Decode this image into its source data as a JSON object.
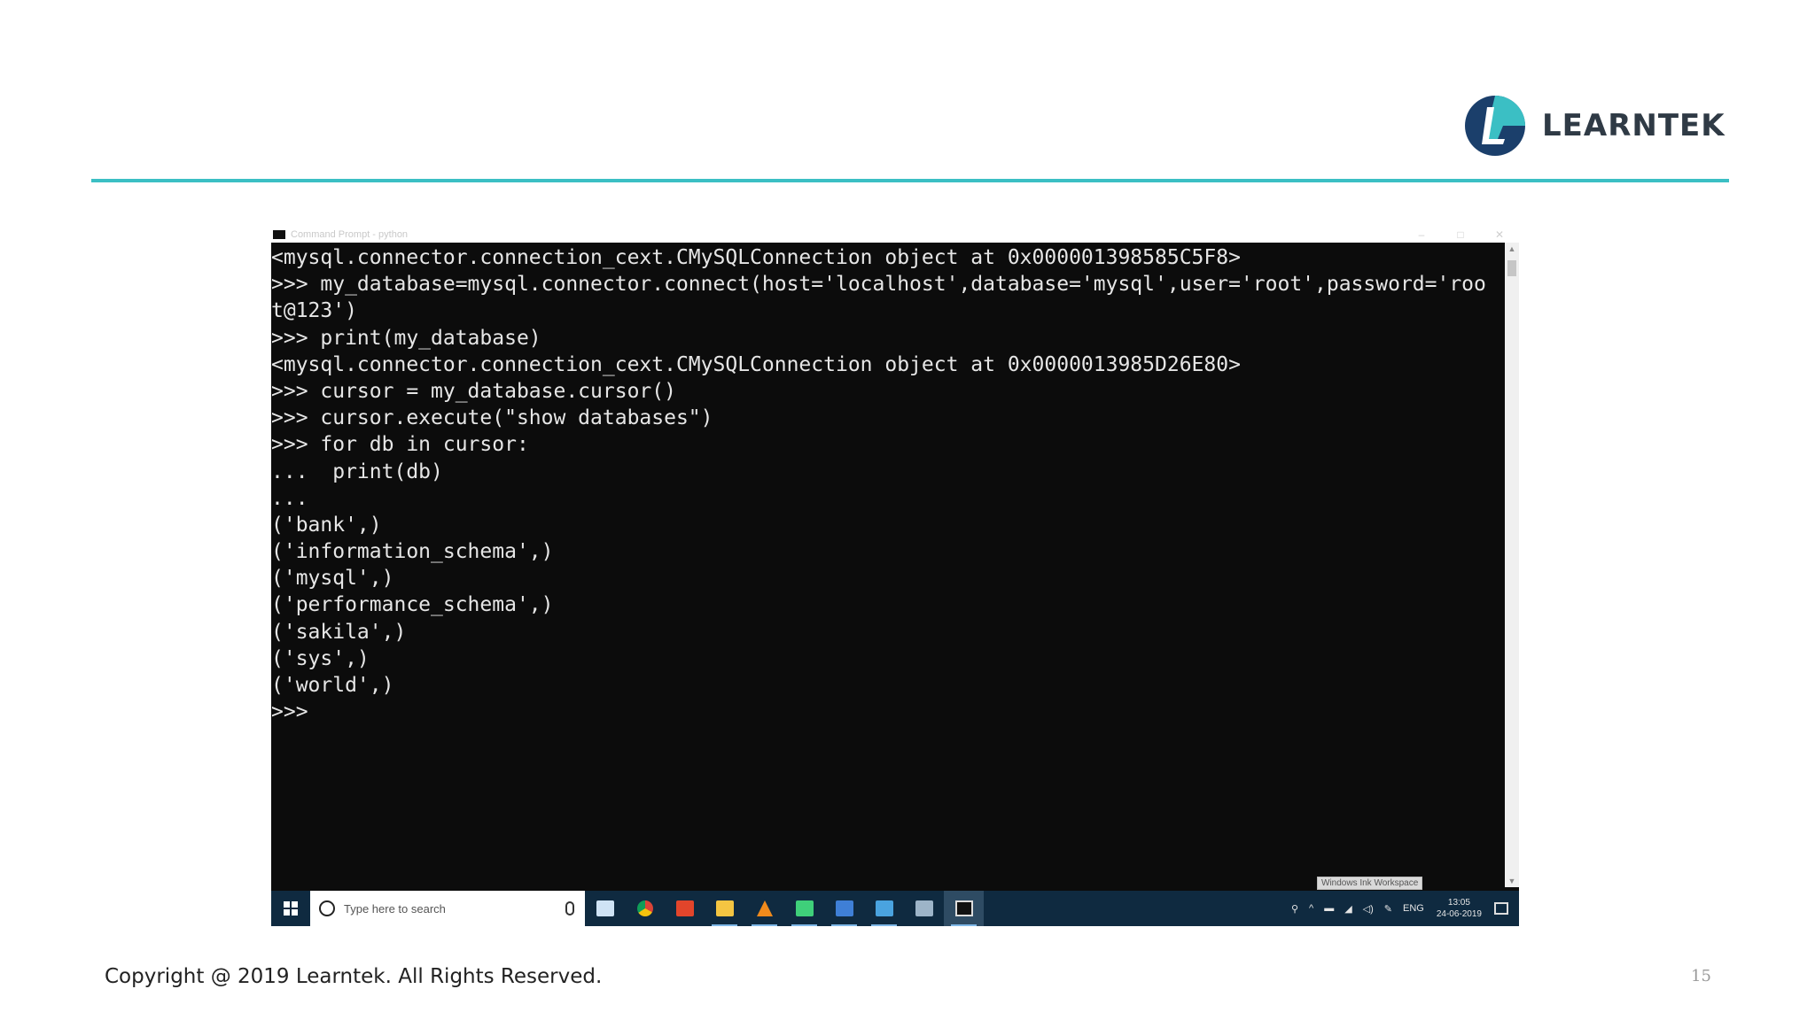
{
  "brand": {
    "name": "LEARNTEK"
  },
  "window": {
    "title": "Command Prompt - python",
    "minimize": "–",
    "maximize": "□",
    "close": "✕"
  },
  "console": {
    "lines": [
      "<mysql.connector.connection_cext.CMySQLConnection object at 0x000001398585C5F8>",
      ">>> my_database=mysql.connector.connect(host='localhost',database='mysql',user='root',password='roo",
      "t@123')",
      ">>> print(my_database)",
      "<mysql.connector.connection_cext.CMySQLConnection object at 0x0000013985D26E80>",
      ">>> cursor = my_database.cursor()",
      ">>> cursor.execute(\"show databases\")",
      ">>> for db in cursor:",
      "...  print(db)",
      "...",
      "('bank',)",
      "('information_schema',)",
      "('mysql',)",
      "('performance_schema',)",
      "('sakila',)",
      "('sys',)",
      "('world',)",
      ">>>"
    ]
  },
  "tooltip": "Windows Ink Workspace",
  "taskbar": {
    "search_placeholder": "Type here to search",
    "apps": [
      {
        "name": "task-view-icon",
        "color": "#cfe3f5"
      },
      {
        "name": "chrome-icon",
        "color": "#e8b830"
      },
      {
        "name": "adobe-icon",
        "color": "#e2452b"
      },
      {
        "name": "file-explorer-icon",
        "color": "#f4c542"
      },
      {
        "name": "vlc-icon",
        "color": "#f08a1c"
      },
      {
        "name": "pycharm-icon",
        "color": "#3fd07a"
      },
      {
        "name": "word-icon",
        "color": "#3f7fd6"
      },
      {
        "name": "mail-icon",
        "color": "#4aa3df"
      },
      {
        "name": "snipping-icon",
        "color": "#9db4c8"
      },
      {
        "name": "command-prompt-icon",
        "color": "#111111"
      }
    ],
    "tray": {
      "language": "ENG",
      "time": "13:05",
      "date": "24-06-2019"
    }
  },
  "footer": {
    "copyright": "Copyright @ 2019 Learntek. All Rights Reserved.",
    "page_number": "15"
  },
  "colors": {
    "accent": "#3bbfc4",
    "brand_dark": "#1b3f6b",
    "console_bg": "#0c0c0c",
    "taskbar_bg": "#0f2a40"
  }
}
